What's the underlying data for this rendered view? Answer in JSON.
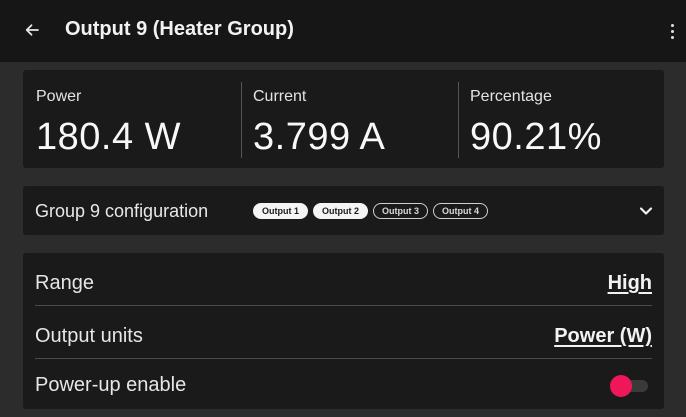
{
  "header": {
    "title": "Output 9 (Heater Group)",
    "back_icon": "arrow-left-icon",
    "menu_icon": "more-vert-icon"
  },
  "stats": [
    {
      "label": "Power",
      "value": "180.4 W"
    },
    {
      "label": "Current",
      "value": "3.799 A"
    },
    {
      "label": "Percentage",
      "value": "90.21%"
    }
  ],
  "group": {
    "title": "Group 9 configuration",
    "chips": [
      {
        "label": "Output 1",
        "active": true
      },
      {
        "label": "Output 2",
        "active": true
      },
      {
        "label": "Output 3",
        "active": false
      },
      {
        "label": "Output 4",
        "active": false
      }
    ],
    "expand_icon": "chevron-down-icon"
  },
  "settings": {
    "range": {
      "label": "Range",
      "value": "High"
    },
    "units": {
      "label": "Output units",
      "value": "Power (W)"
    },
    "power_up": {
      "label": "Power-up enable",
      "enabled": true
    }
  },
  "colors": {
    "accent": "#f0165a",
    "background": "#2c2c2c",
    "card": "#1a1a1a",
    "topbar": "#161616"
  }
}
